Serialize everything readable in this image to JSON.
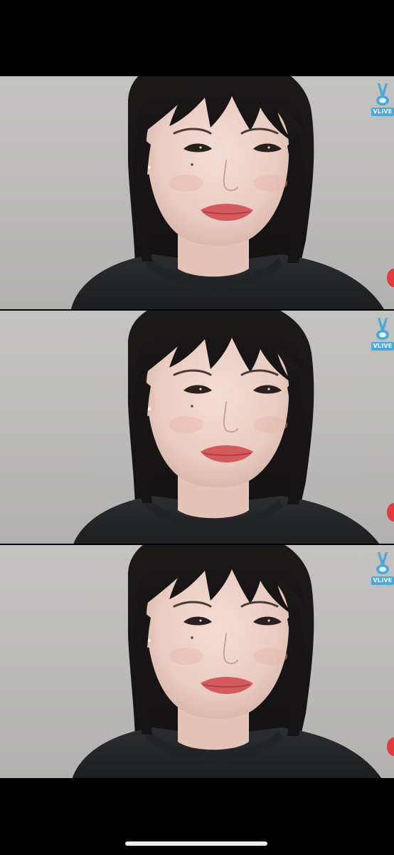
{
  "screen": {
    "background_color": "#000000"
  },
  "panels": [
    {
      "badge": {
        "label": "VLIVE",
        "icon": "v-hand-icon",
        "color": "#4aa9d8"
      },
      "live_indicator_color": "#e23a3f"
    },
    {
      "badge": {
        "label": "VLIVE",
        "icon": "v-hand-icon",
        "color": "#4aa9d8"
      },
      "live_indicator_color": "#e23a3f"
    },
    {
      "badge": {
        "label": "VLIVE",
        "icon": "v-hand-icon",
        "color": "#4aa9d8"
      },
      "live_indicator_color": "#e23a3f"
    }
  ],
  "home_indicator": {
    "color": "#ececec"
  }
}
